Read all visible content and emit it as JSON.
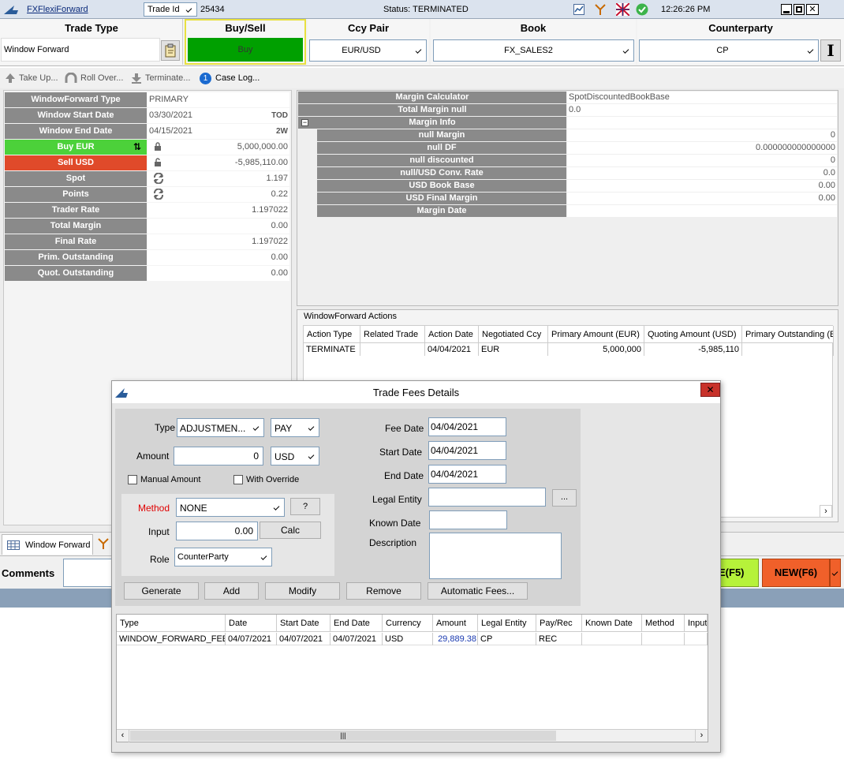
{
  "titlebar": {
    "app_name": "FXFlexiForward",
    "trade_id_label": "Trade Id",
    "trade_id": "25434",
    "status": "Status: TERMINATED",
    "time": "12:26:26 PM"
  },
  "header": {
    "trade_type_label": "Trade Type",
    "trade_type_value": "Window Forward",
    "buy_sell_label": "Buy/Sell",
    "buy_sell_value": "Buy",
    "ccy_pair_label": "Ccy Pair",
    "ccy_pair_value": "EUR/USD",
    "book_label": "Book",
    "book_value": "FX_SALES2",
    "counterparty_label": "Counterparty",
    "counterparty_value": "CP"
  },
  "toolbar": {
    "take_up": "Take Up...",
    "roll_over": "Roll Over...",
    "terminate": "Terminate...",
    "case_log_badge": "1",
    "case_log": "Case Log..."
  },
  "left_panel": [
    {
      "label": "WindowForward Type",
      "value": "PRIMARY",
      "suffix": ""
    },
    {
      "label": "Window Start Date",
      "value": "03/30/2021",
      "suffix": "TOD"
    },
    {
      "label": "Window End Date",
      "value": "04/15/2021",
      "suffix": "2W"
    },
    {
      "label": "Buy EUR",
      "value": "5,000,000.00",
      "suffix": ""
    },
    {
      "label": "Sell USD",
      "value": "-5,985,110.00",
      "suffix": ""
    },
    {
      "label": "Spot",
      "value": "1.197",
      "suffix": ""
    },
    {
      "label": "Points",
      "value": "0.22",
      "suffix": ""
    },
    {
      "label": "Trader Rate",
      "value": "1.197022",
      "suffix": ""
    },
    {
      "label": "Total Margin",
      "value": "0.00",
      "suffix": ""
    },
    {
      "label": "Final Rate",
      "value": "1.197022",
      "suffix": ""
    },
    {
      "label": "Prim. Outstanding",
      "value": "0.00",
      "suffix": ""
    },
    {
      "label": "Quot. Outstanding",
      "value": "0.00",
      "suffix": ""
    }
  ],
  "margin": {
    "rows": [
      {
        "label": "Margin Calculator",
        "value": "SpotDiscountedBookBase"
      },
      {
        "label": "Total Margin null",
        "value": "0.0"
      },
      {
        "label": "Margin Info",
        "value": ""
      },
      {
        "label": "null Margin",
        "value": "0"
      },
      {
        "label": "null DF",
        "value": "0.000000000000000"
      },
      {
        "label": "null discounted",
        "value": "0"
      },
      {
        "label": "null/USD Conv. Rate",
        "value": "0.0"
      },
      {
        "label": "USD Book Base",
        "value": "0.00"
      },
      {
        "label": "USD Final Margin",
        "value": "0.00"
      },
      {
        "label": "Margin Date",
        "value": ""
      }
    ]
  },
  "actions": {
    "title": "WindowForward Actions",
    "columns": [
      "Action Type",
      "Related Trade",
      "Action Date",
      "Negotiated Ccy",
      "Primary Amount (EUR)",
      "Quoting Amount (USD)",
      "Primary Outstanding (E"
    ],
    "rows": [
      [
        "TERMINATE",
        "",
        "04/04/2021",
        "EUR",
        "5,000,000",
        "-5,985,110",
        ""
      ]
    ]
  },
  "bottom": {
    "tab_window_forward": "Window Forward",
    "comments_label": "Comments",
    "f5_button": "E(F5)",
    "new_button": "NEW(F6)"
  },
  "dialog": {
    "title": "Trade Fees Details",
    "type_label": "Type",
    "type_value": "ADJUSTMEN...",
    "pay_value": "PAY",
    "amount_label": "Amount",
    "amount_value": "0",
    "currency_value": "USD",
    "manual_amount": "Manual Amount",
    "with_override": "With Override",
    "method_label": "Method",
    "method_value": "NONE",
    "help_button": "?",
    "input_label": "Input",
    "input_value": "0.00",
    "calc_button": "Calc",
    "role_label": "Role",
    "role_value": "CounterParty",
    "fee_date_label": "Fee Date",
    "fee_date": "04/04/2021",
    "start_date_label": "Start Date",
    "start_date": "04/04/2021",
    "end_date_label": "End Date",
    "end_date": "04/04/2021",
    "legal_entity_label": "Legal Entity",
    "legal_entity_button": "...",
    "known_date_label": "Known Date",
    "description_label": "Description",
    "generate": "Generate",
    "add": "Add",
    "modify": "Modify",
    "remove": "Remove",
    "automatic_fees": "Automatic Fees...",
    "columns": [
      "Type",
      "Date",
      "Start Date",
      "End Date",
      "Currency",
      "Amount",
      "Legal Entity",
      "Pay/Rec",
      "Known Date",
      "Method",
      "Input"
    ],
    "rows": [
      [
        "WINDOW_FORWARD_FEE",
        "04/07/2021",
        "04/07/2021",
        "04/07/2021",
        "USD",
        "29,889.38",
        "CP",
        "REC",
        "",
        "",
        ""
      ]
    ]
  },
  "colors": {
    "buy_green": "#00a000",
    "buy_eur_green": "#4cd13a",
    "sell_red": "#e04a2a",
    "f5_yellow": "#b6f23a",
    "new_orange": "#f0602a",
    "label_grey": "#8a8a8a"
  }
}
